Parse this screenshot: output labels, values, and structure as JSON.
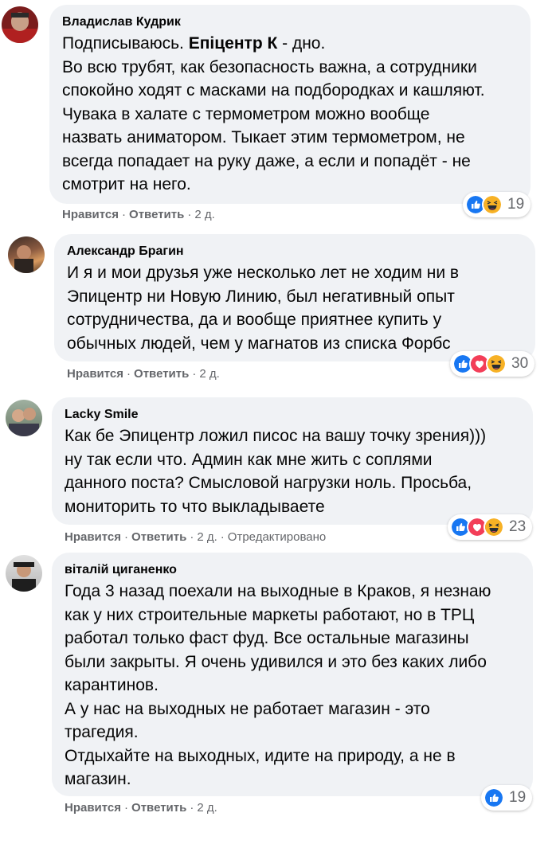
{
  "comments": [
    {
      "author": "Владислав Кудрик",
      "lines": [
        {
          "pre": "Подписываюсь. ",
          "bold": "Епіцентр К",
          "post": " - дно."
        },
        {
          "pre": "Во всю трубят, как безопасность важна, а сотрудники",
          "bold": "",
          "post": ""
        },
        {
          "pre": "спокойно ходят с масками на подбородках и кашляют.",
          "bold": "",
          "post": ""
        },
        {
          "pre": "Чувака в халате с термометром можно вообще",
          "bold": "",
          "post": ""
        },
        {
          "pre": "назвать аниматором. Тыкает этим термометром, не",
          "bold": "",
          "post": ""
        },
        {
          "pre": "всегда попадает на руку даже, а если и попадёт - не",
          "bold": "",
          "post": ""
        },
        {
          "pre": "смотрит на него.",
          "bold": "",
          "post": ""
        }
      ],
      "like": "Нравится",
      "reply": "Ответить",
      "time": "2 д.",
      "edited": "",
      "reactions": [
        "like",
        "haha"
      ],
      "reaction_count": "19"
    },
    {
      "author": "Александр Брагин",
      "lines": [
        {
          "pre": "И я и мои друзья уже несколько лет не ходим ни в",
          "bold": "",
          "post": ""
        },
        {
          "pre": "Эпицентр ни Новую Линию, был негативный опыт",
          "bold": "",
          "post": ""
        },
        {
          "pre": "сотрудничества, да и вообще приятнее купить у",
          "bold": "",
          "post": ""
        },
        {
          "pre": "обычных людей, чем у магнатов из списка Форбс",
          "bold": "",
          "post": ""
        }
      ],
      "like": "Нравится",
      "reply": "Ответить",
      "time": "2 д.",
      "edited": "",
      "reactions": [
        "like",
        "love",
        "haha"
      ],
      "reaction_count": "30"
    },
    {
      "author": "Lacky Smile",
      "lines": [
        {
          "pre": "Как бе Эпицентр ложил писос на вашу точку зрения)))",
          "bold": "",
          "post": ""
        },
        {
          "pre": "ну так если что. Админ как мне жить с соплями",
          "bold": "",
          "post": ""
        },
        {
          "pre": "данного поста? Смысловой нагрузки ноль. Просьба,",
          "bold": "",
          "post": ""
        },
        {
          "pre": "мониторить то что выкладываете",
          "bold": "",
          "post": ""
        }
      ],
      "like": "Нравится",
      "reply": "Ответить",
      "time": "2 д.",
      "edited": "Отредактировано",
      "reactions": [
        "like",
        "love",
        "haha"
      ],
      "reaction_count": "23"
    },
    {
      "author": "віталій циганенко",
      "lines": [
        {
          "pre": "Года 3 назад поехали на выходные в Краков, я незнаю",
          "bold": "",
          "post": ""
        },
        {
          "pre": "как у них строительные маркеты работают, но в ТРЦ",
          "bold": "",
          "post": ""
        },
        {
          "pre": "работал только фаст фуд. Все остальные магазины",
          "bold": "",
          "post": ""
        },
        {
          "pre": "были закрыты. Я очень удивился и это без каких либо",
          "bold": "",
          "post": ""
        },
        {
          "pre": "карантинов.",
          "bold": "",
          "post": ""
        },
        {
          "pre": "А у нас на выходных не работает магазин - это",
          "bold": "",
          "post": ""
        },
        {
          "pre": "трагедия.",
          "bold": "",
          "post": ""
        },
        {
          "pre": "Отдыхайте на выходных, идите на природу, а не в",
          "bold": "",
          "post": ""
        },
        {
          "pre": "магазин.",
          "bold": "",
          "post": ""
        }
      ],
      "like": "Нравится",
      "reply": "Ответить",
      "time": "2 д.",
      "edited": "",
      "reactions": [
        "like"
      ],
      "reaction_count": "19"
    }
  ],
  "colors": {
    "bubble": "#f0f2f5",
    "secondary_text": "#65676b",
    "like_blue": "#1877f2",
    "love_red": "#f33e58",
    "haha_yellow": "#f7b125"
  }
}
